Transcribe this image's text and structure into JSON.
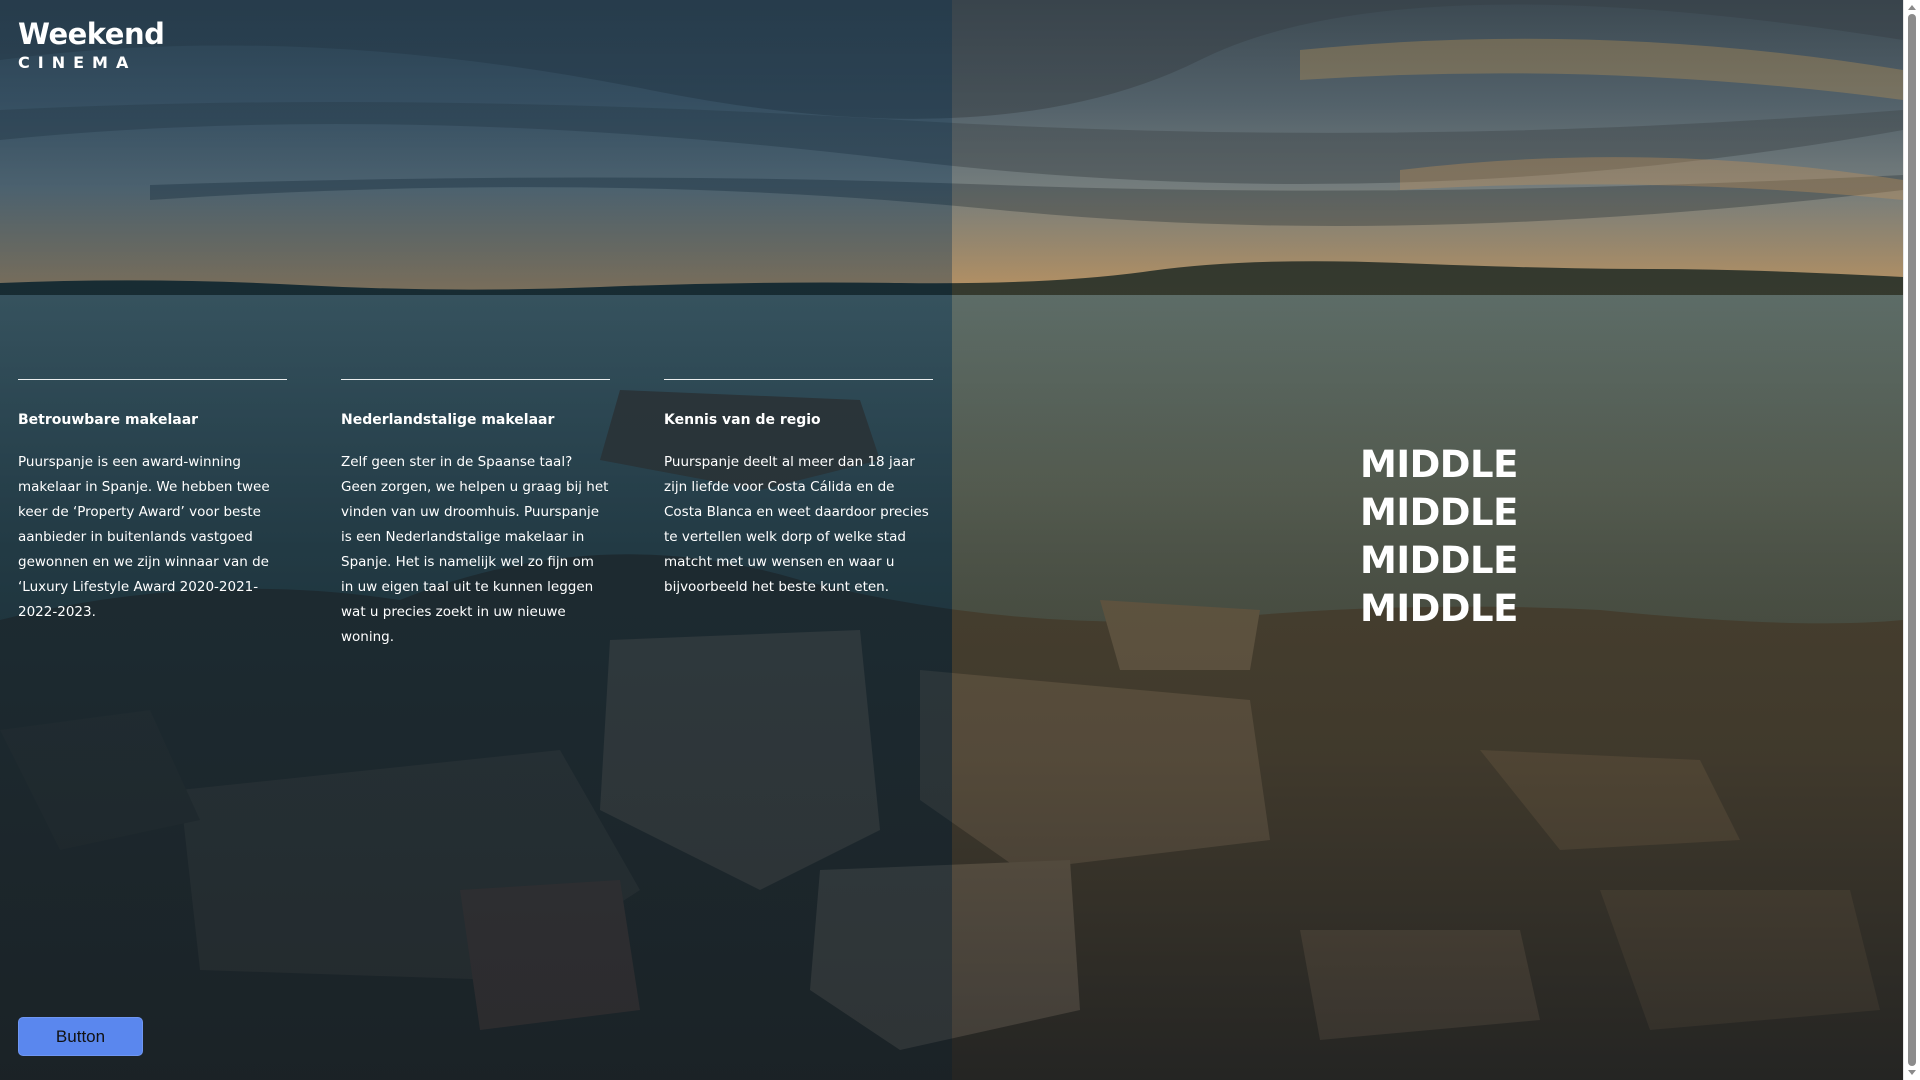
{
  "logo": {
    "title": "Weekend",
    "subtitle": "CINEMA"
  },
  "features": [
    {
      "heading": "Betrouwbare makelaar",
      "text": "Puurspanje is een award-winning makelaar in Spanje. We hebben twee keer de ‘Property Award’ voor beste aanbieder in buitenlands vastgoed gewonnen en we zijn winnaar van de ‘Luxury Lifestyle Award 2020-2021-2022-2023."
    },
    {
      "heading": "Nederlandstalige makelaar",
      "text": "Zelf geen ster in de Spaanse taal? Geen zorgen, we helpen u graag bij het vinden van uw droomhuis. Puurspanje is een Nederlandstalige makelaar in Spanje. Het is namelijk wel zo fijn om in uw eigen taal uit te kunnen leggen wat u precies zoekt in uw nieuwe woning."
    },
    {
      "heading": "Kennis van de regio",
      "text": "Puurspanje deelt al meer dan 18 jaar zijn liefde voor Costa Cálida en de Costa Blanca en weet daardoor precies te vertellen welk dorp of welke stad matcht met uw wensen en waar u bijvoorbeeld het beste kunt eten."
    }
  ],
  "middle": [
    "MIDDLE",
    "MIDDLE",
    "MIDDLE",
    "MIDDLE"
  ],
  "cta": {
    "label": "Button"
  },
  "colors": {
    "button": "#5a87ee",
    "text": "#ffffff"
  },
  "icons": {
    "scroll_up": "triangle-up-icon",
    "scroll_down": "triangle-down-icon"
  }
}
